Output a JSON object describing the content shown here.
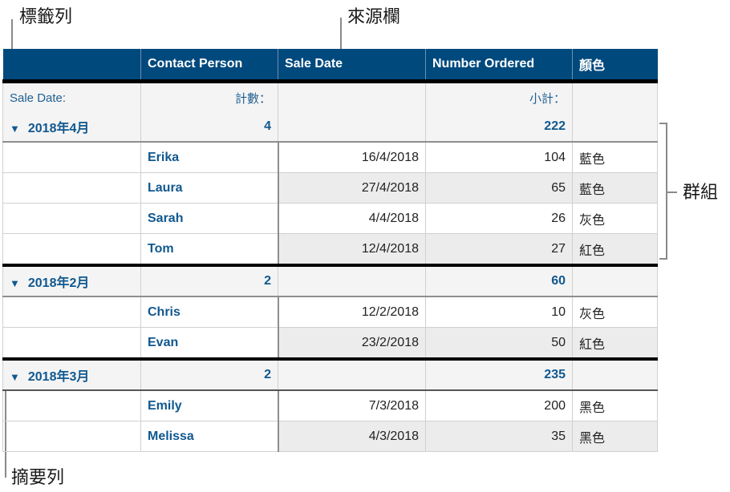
{
  "callouts": {
    "label_row": "標籤列",
    "source_column": "來源欄",
    "group": "群組",
    "summary_row": "摘要列"
  },
  "table": {
    "headers": [
      "",
      "Contact Person",
      "Sale Date",
      "Number Ordered",
      "顏色"
    ],
    "label_row": {
      "group_label": "Sale Date:",
      "count_label": "計數：",
      "subtotal_label": "小計："
    },
    "groups": [
      {
        "name": "2018年4月",
        "count": "4",
        "subtotal": "222",
        "rows": [
          {
            "person": "Erika",
            "date": "16/4/2018",
            "qty": "104",
            "color": "藍色"
          },
          {
            "person": "Laura",
            "date": "27/4/2018",
            "qty": "65",
            "color": "藍色"
          },
          {
            "person": "Sarah",
            "date": "4/4/2018",
            "qty": "26",
            "color": "灰色"
          },
          {
            "person": "Tom",
            "date": "12/4/2018",
            "qty": "27",
            "color": "紅色"
          }
        ]
      },
      {
        "name": "2018年2月",
        "count": "2",
        "subtotal": "60",
        "rows": [
          {
            "person": "Chris",
            "date": "12/2/2018",
            "qty": "10",
            "color": "灰色"
          },
          {
            "person": "Evan",
            "date": "23/2/2018",
            "qty": "50",
            "color": "紅色"
          }
        ]
      },
      {
        "name": "2018年3月",
        "count": "2",
        "subtotal": "235",
        "rows": [
          {
            "person": "Emily",
            "date": "7/3/2018",
            "qty": "200",
            "color": "黑色"
          },
          {
            "person": "Melissa",
            "date": "4/3/2018",
            "qty": "35",
            "color": "黑色"
          }
        ]
      }
    ]
  },
  "icons": {
    "disclosure_triangle": "▼"
  },
  "colors": {
    "header_bg": "#00497d",
    "accent_text": "#10588f"
  }
}
